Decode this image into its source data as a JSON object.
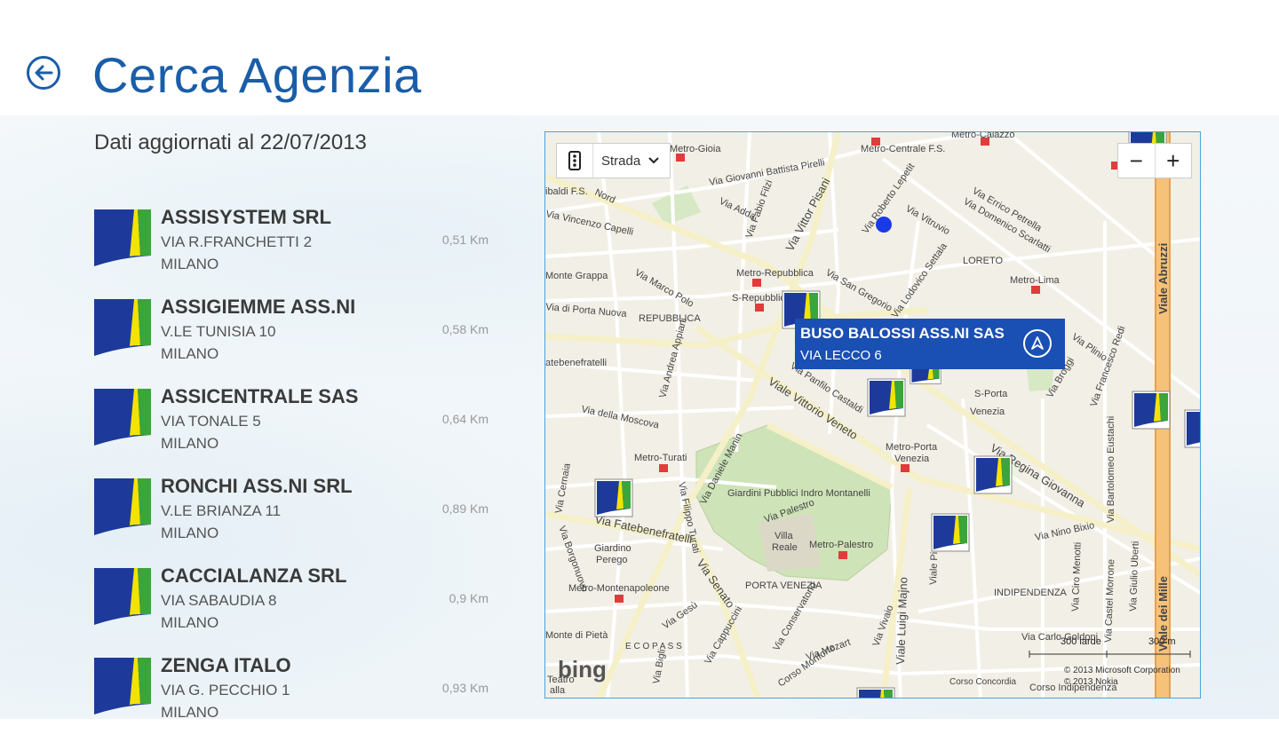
{
  "header": {
    "title": "Cerca Agenzia"
  },
  "updated_label": "Dati aggiornati al 22/07/2013",
  "agencies": [
    {
      "name": "ASSISYSTEM SRL",
      "address": "VIA R.FRANCHETTI 2",
      "city": "MILANO",
      "distance": "0,51 Km"
    },
    {
      "name": "ASSIGIEMME ASS.NI",
      "address": "V.LE TUNISIA 10",
      "city": "MILANO",
      "distance": "0,58 Km"
    },
    {
      "name": "ASSICENTRALE SAS",
      "address": "VIA TONALE 5",
      "city": "MILANO",
      "distance": "0,64 Km"
    },
    {
      "name": "RONCHI ASS.NI SRL",
      "address": "V.LE BRIANZA 11",
      "city": "MILANO",
      "distance": "0,89 Km"
    },
    {
      "name": "CACCIALANZA SRL",
      "address": "VIA SABAUDIA 8",
      "city": "MILANO",
      "distance": "0,9 Km"
    },
    {
      "name": "ZENGA ITALO",
      "address": "VIA G. PECCHIO 1",
      "city": "MILANO",
      "distance": "0,93 Km"
    }
  ],
  "map": {
    "type_selector": "Strada",
    "zoom_out": "−",
    "zoom_in": "+",
    "callout": {
      "name": "BUSO BALOSSI ASS.NI SAS",
      "address": "VIA LECCO 6"
    },
    "brand": "bing",
    "scale_yards": "300 iarde",
    "scale_meters": "300 m",
    "copyright_1": "© 2013 Microsoft Corporation",
    "copyright_2": "© 2013 Nokia",
    "labels": {
      "via_nord": "Nord",
      "metro_gioia": "Metro-Gioia",
      "metro_centrale": "Metro-Centrale F.S.",
      "metro_caiazzo": "Metro-Caiazzo",
      "via_giovanni_battista_pirelli": "Via Giovanni Battista Pirelli",
      "via_adda": "Via Adda",
      "via_fabio_filzi": "Via Fabio Filzi",
      "via_vittor_pisani": "Via Vittor Pisani",
      "via_roberto_lepetit": "Via Roberto Lepetit",
      "via_vitruvio": "Via Vitruvio",
      "via_errico_petrella": "Via Errico Petrella",
      "via_domenico_scarlatti": "Via Domenico Scarlatti",
      "viale_abruzzi": "Viale Abruzzi",
      "via_vincenzo_capelli": "Via Vincenzo Capelli",
      "ibaldi_fs": "ibaldi F.S.",
      "monte_grappa": "Monte Grappa",
      "via_marco_polo": "Via Marco Polo",
      "metro_repubblica": "Metro-Repubblica",
      "s_repubblica": "S-Repubblica",
      "via_san_gregorio": "Via San Gregorio",
      "lodovico_settala": "Via Lodovico Settala",
      "loreto": "LORETO",
      "metro_lima": "Metro-Lima",
      "porta_nuova": "Via di Porta Nuova",
      "repubblica": "REPUBBLICA",
      "fatebenefratelli_top": "atebenefratelli",
      "via_andrea_appiani": "Via Andrea Appiani",
      "via_della_moscova": "Via della Moscova",
      "viale_vittorio_veneto": "Viale Vittorio Veneto",
      "via_panfilo_castaldi": "Via Panfilo Castaldi",
      "s_porta_venezia": "S-Porta",
      "venezia": "Venezia",
      "via_plinio": "Via Plinio",
      "via_broggi": "Via Broggi",
      "francesco_redi": "Via Francesco Redi",
      "via_bartolomeo_eustachi": "Via Bartolomeo Eustachi",
      "metro_porta_venezia": "Metro-Porta",
      "metro_porta_venezia2": "Venezia",
      "via_regina_giovanna": "Via Regina Giovanna",
      "metro_turati": "Metro-Turati",
      "via_daniele_manin": "Via Daniele Manin",
      "via_filippo_turati": "Via Filippo Turati",
      "giardini": "Giardini Pubblici Indro Montanelli",
      "via_cernaia": "Via Cernaia",
      "via_fatebenefratelli": "Via Fatebenefratelli",
      "via_palestro": "Via Palestro",
      "villa_reale": "Villa",
      "villa_reale2": "Reale",
      "metro_palestro": "Metro-Palestro",
      "via_nino_bixio": "Via Nino Bixio",
      "giardino_perego": "Giardino",
      "giardino_perego2": "Perego",
      "via_senato": "Via Senato",
      "porta_venezia": "PORTA VENEZIA",
      "viale_piave": "Viale Piave",
      "viale_luigi_majno": "Viale Luigi Majno",
      "indipendenza": "INDIPENDENZA",
      "via_ciro_menotti": "Via Ciro Menotti",
      "via_castel_morrone": "Via Castel Morrone",
      "via_giulio_uberti": "Via Giulio Uberti",
      "metro_montenapoleone": "Metro-Montenapoleone",
      "via_borgonuovo": "Via Borgonuovo",
      "via_gesu": "Via Gesù",
      "monte_di_pieta": "Monte di Pietà",
      "ecopass": "E C O P A S S",
      "via_mozart": "Via Mozart",
      "via_vivaio": "Via Vivaio",
      "corso_concordia": "Corso Concordia",
      "corso_indipendenza": "Corso Indipendenza",
      "via_carlo_goldoni": "Via Carlo Goldoni",
      "viale_dei_mille": "Viale dei Mille",
      "via_bigli": "Via Bigli",
      "teatro_alla": "Teatro",
      "teatro_alla2": "alla",
      "via_conservatorio": "Via Conservatorio",
      "corso_monforte": "Corso Monforte",
      "via_cappuccini": "Via Cappuccini"
    }
  },
  "colors": {
    "accent": "#1a5da8",
    "callout_bg": "#1a4fb3",
    "logo_blue": "#1d3a9a",
    "logo_yellow": "#f3e300",
    "logo_green": "#3aa53a",
    "highway": "#f0b060"
  }
}
